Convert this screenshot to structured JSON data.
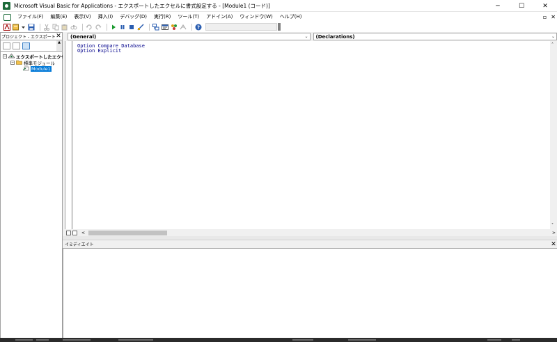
{
  "window": {
    "title": "Microsoft Visual Basic for Applications - エクスポートしたエクセルに書式設定する - [Module1 (コード)]",
    "minimize": "─",
    "maximize": "☐",
    "close": "✕"
  },
  "menu": {
    "items": [
      "ファイル(F)",
      "編集(E)",
      "表示(V)",
      "挿入(I)",
      "デバッグ(D)",
      "実行(R)",
      "ツール(T)",
      "アドイン(A)",
      "ウィンドウ(W)",
      "ヘルプ(H)"
    ],
    "mdi_restore": "▫",
    "mdi_close": "✕"
  },
  "project": {
    "header_title": "プロジェクト - エクスポートしたエ",
    "close": "✕",
    "root_expander": "−",
    "root_label": "エクスポートしたエクセ",
    "folder_expander": "−",
    "folder_label": "標準モジュール",
    "module_label": "Module1"
  },
  "code": {
    "object_combo": "(General)",
    "proc_combo": "(Declarations)",
    "lines": [
      "Option Compare Database",
      "Option Explicit"
    ]
  },
  "immediate": {
    "title": "イミディエイト",
    "close": "✕"
  },
  "colors": {
    "code_text": "#00008b",
    "selection": "#0078d7",
    "brand_green": "#1d6b3a"
  }
}
